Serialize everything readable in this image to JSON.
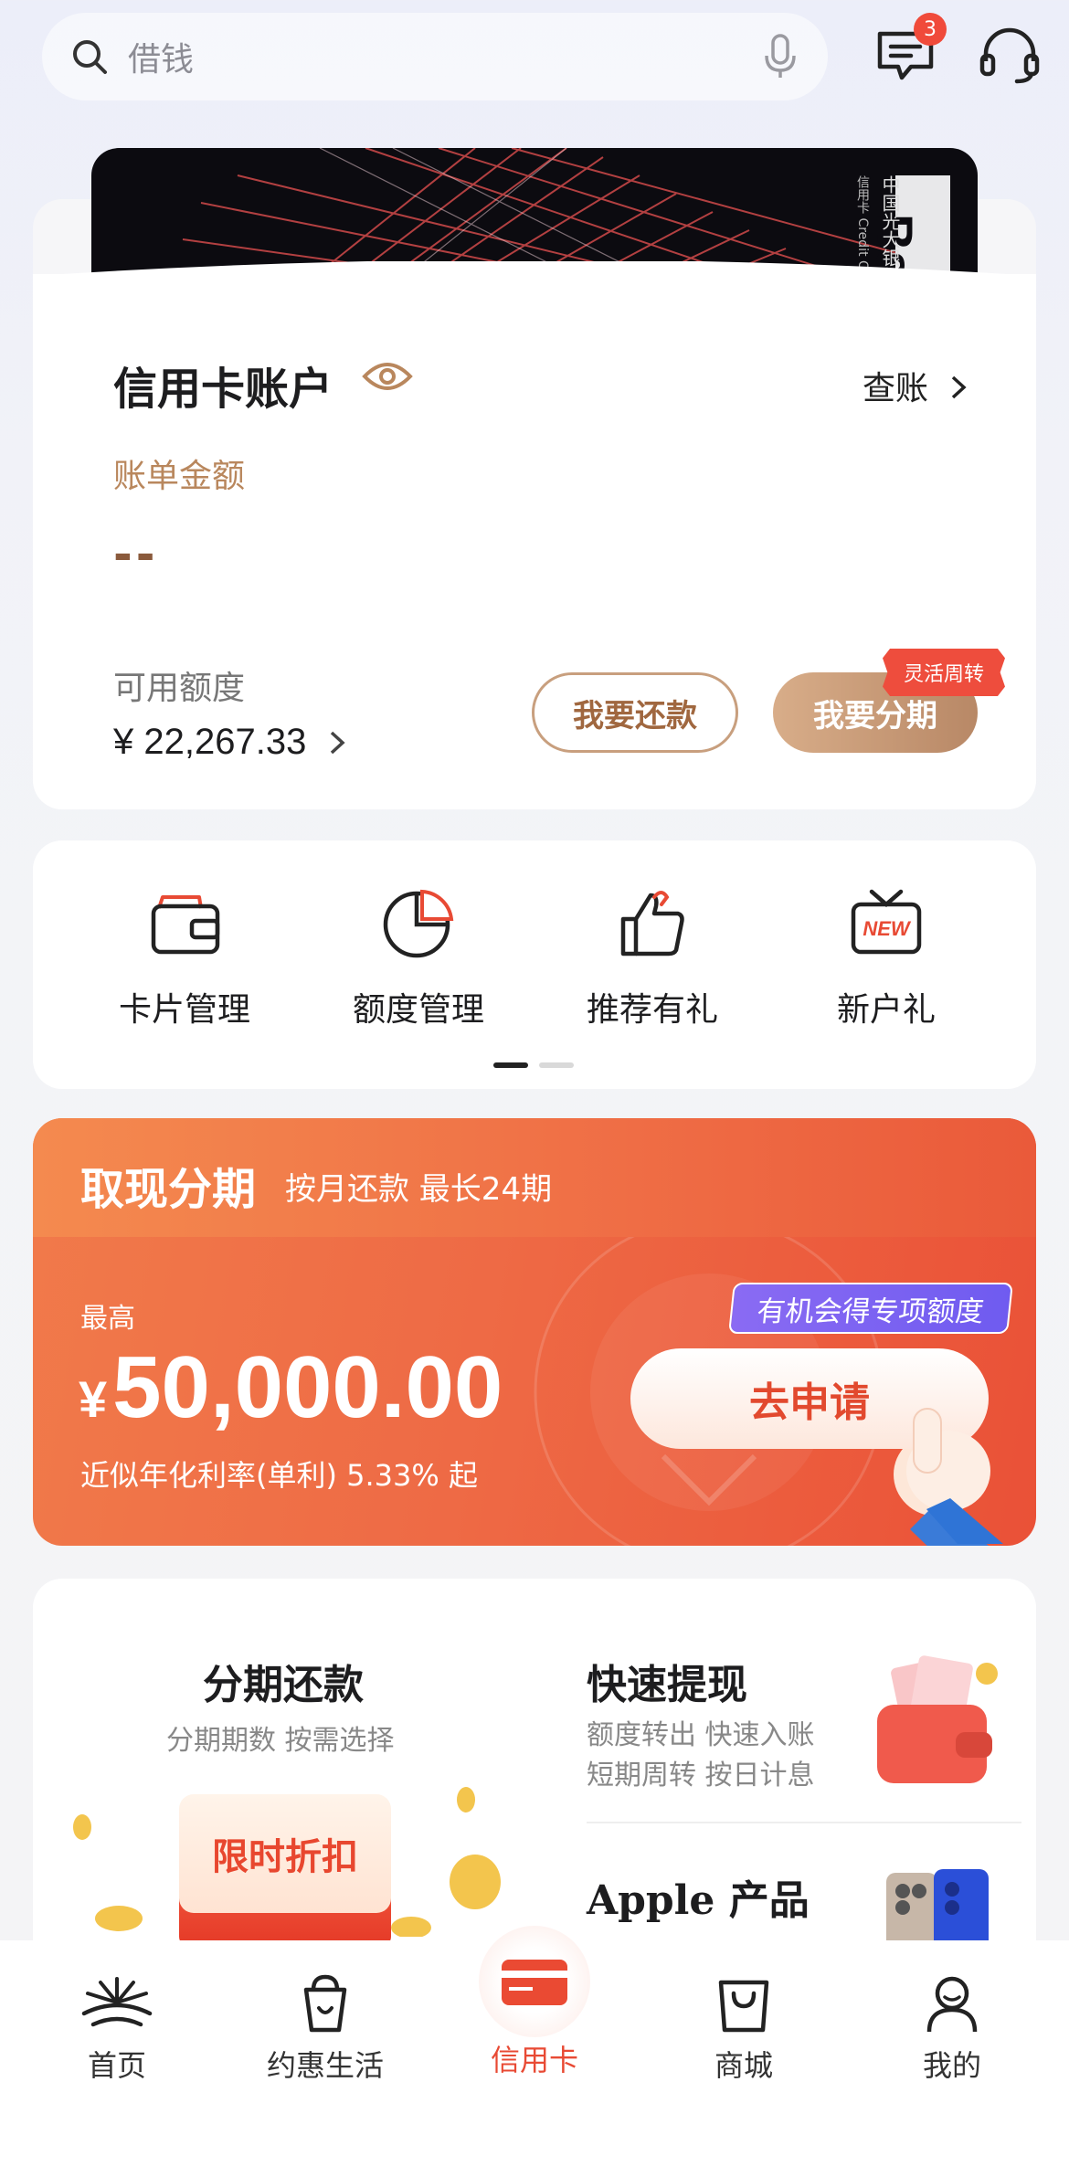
{
  "search": {
    "placeholder": "借钱"
  },
  "header": {
    "messages_badge": "3"
  },
  "account": {
    "title": "信用卡账户",
    "view_bill": "查账",
    "bill_label": "账单金额",
    "bill_amount": "--",
    "available_label": "可用额度",
    "available_amount": "¥ 22,267.33",
    "repay_button": "我要还款",
    "installment_button": "我要分期",
    "installment_tag": "灵活周转",
    "card_brand_text": "中国光大银行",
    "card_subtext": "信用卡 Credit Card"
  },
  "quick_actions": [
    {
      "label": "卡片管理",
      "icon": "wallet-icon"
    },
    {
      "label": "额度管理",
      "icon": "pie-chart-icon"
    },
    {
      "label": "推荐有礼",
      "icon": "thumbs-up-icon"
    },
    {
      "label": "新户礼",
      "icon": "new-tv-icon"
    }
  ],
  "cash_banner": {
    "title": "取现分期",
    "subtitle": "按月还款 最长24期",
    "max_label": "最高",
    "currency": "¥",
    "amount": "50,000.00",
    "rate": "近似年化利率(单利) 5.33% 起",
    "tag": "有机会得专项额度",
    "apply_button": "去申请"
  },
  "promo": {
    "left_title": "分期还款",
    "left_subtitle": "分期期数 按需选择",
    "left_badge": "限时折扣",
    "right_title": "快速提现",
    "right_subtitle_1": "额度转出 快速入账",
    "right_subtitle_2": "短期周转 按日计息",
    "right2_title": "Apple 产品"
  },
  "tabs": [
    {
      "label": "首页",
      "icon": "home-sunburst-icon"
    },
    {
      "label": "约惠生活",
      "icon": "cup-icon"
    },
    {
      "label": "信用卡",
      "icon": "credit-card-icon",
      "active": true
    },
    {
      "label": "商城",
      "icon": "shopping-bag-icon"
    },
    {
      "label": "我的",
      "icon": "person-icon"
    }
  ],
  "colors": {
    "accent": "#e84a34",
    "brown": "#b9875d",
    "banner": "#ef6d45"
  }
}
